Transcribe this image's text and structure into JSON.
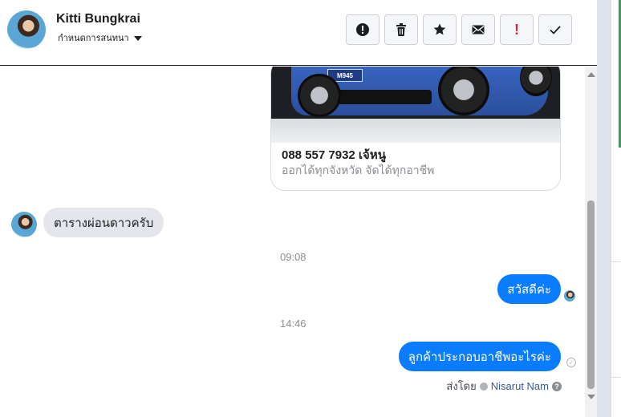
{
  "header": {
    "contact_name": "Kitti Bungkrai",
    "assign_label": "กำหนดการสนทนา",
    "toolbar": {
      "spam_icon": "alert-circle-icon",
      "delete_icon": "trash-icon",
      "star_icon": "star-icon",
      "unread_icon": "envelope-icon",
      "important_label": "!",
      "done_icon": "checkmark-icon"
    }
  },
  "messages": {
    "card": {
      "plate_text": "M945",
      "title": "088 557 7932 เจ้หนู",
      "subtitle": "ออกได้ทุกจังหวัด จัดได้ทุกอาชีพ"
    },
    "incoming": [
      {
        "text": "ตารางผ่อนดาวครับ"
      }
    ],
    "time_1": "09:08",
    "outgoing_1": "สวัสดีค่ะ",
    "time_2": "14:46",
    "outgoing_2": "ลูกค้าประกอบอาชีพอะไรค่ะ",
    "sent_by_label": "ส่งโดย",
    "sent_by_agent": "Nisarut Nam",
    "help_symbol": "?"
  },
  "colors": {
    "outgoing_bubble": "#0a7cff",
    "incoming_bubble": "#e4e6eb",
    "important_red": "#e41e3f",
    "side_green": "#37a058"
  }
}
